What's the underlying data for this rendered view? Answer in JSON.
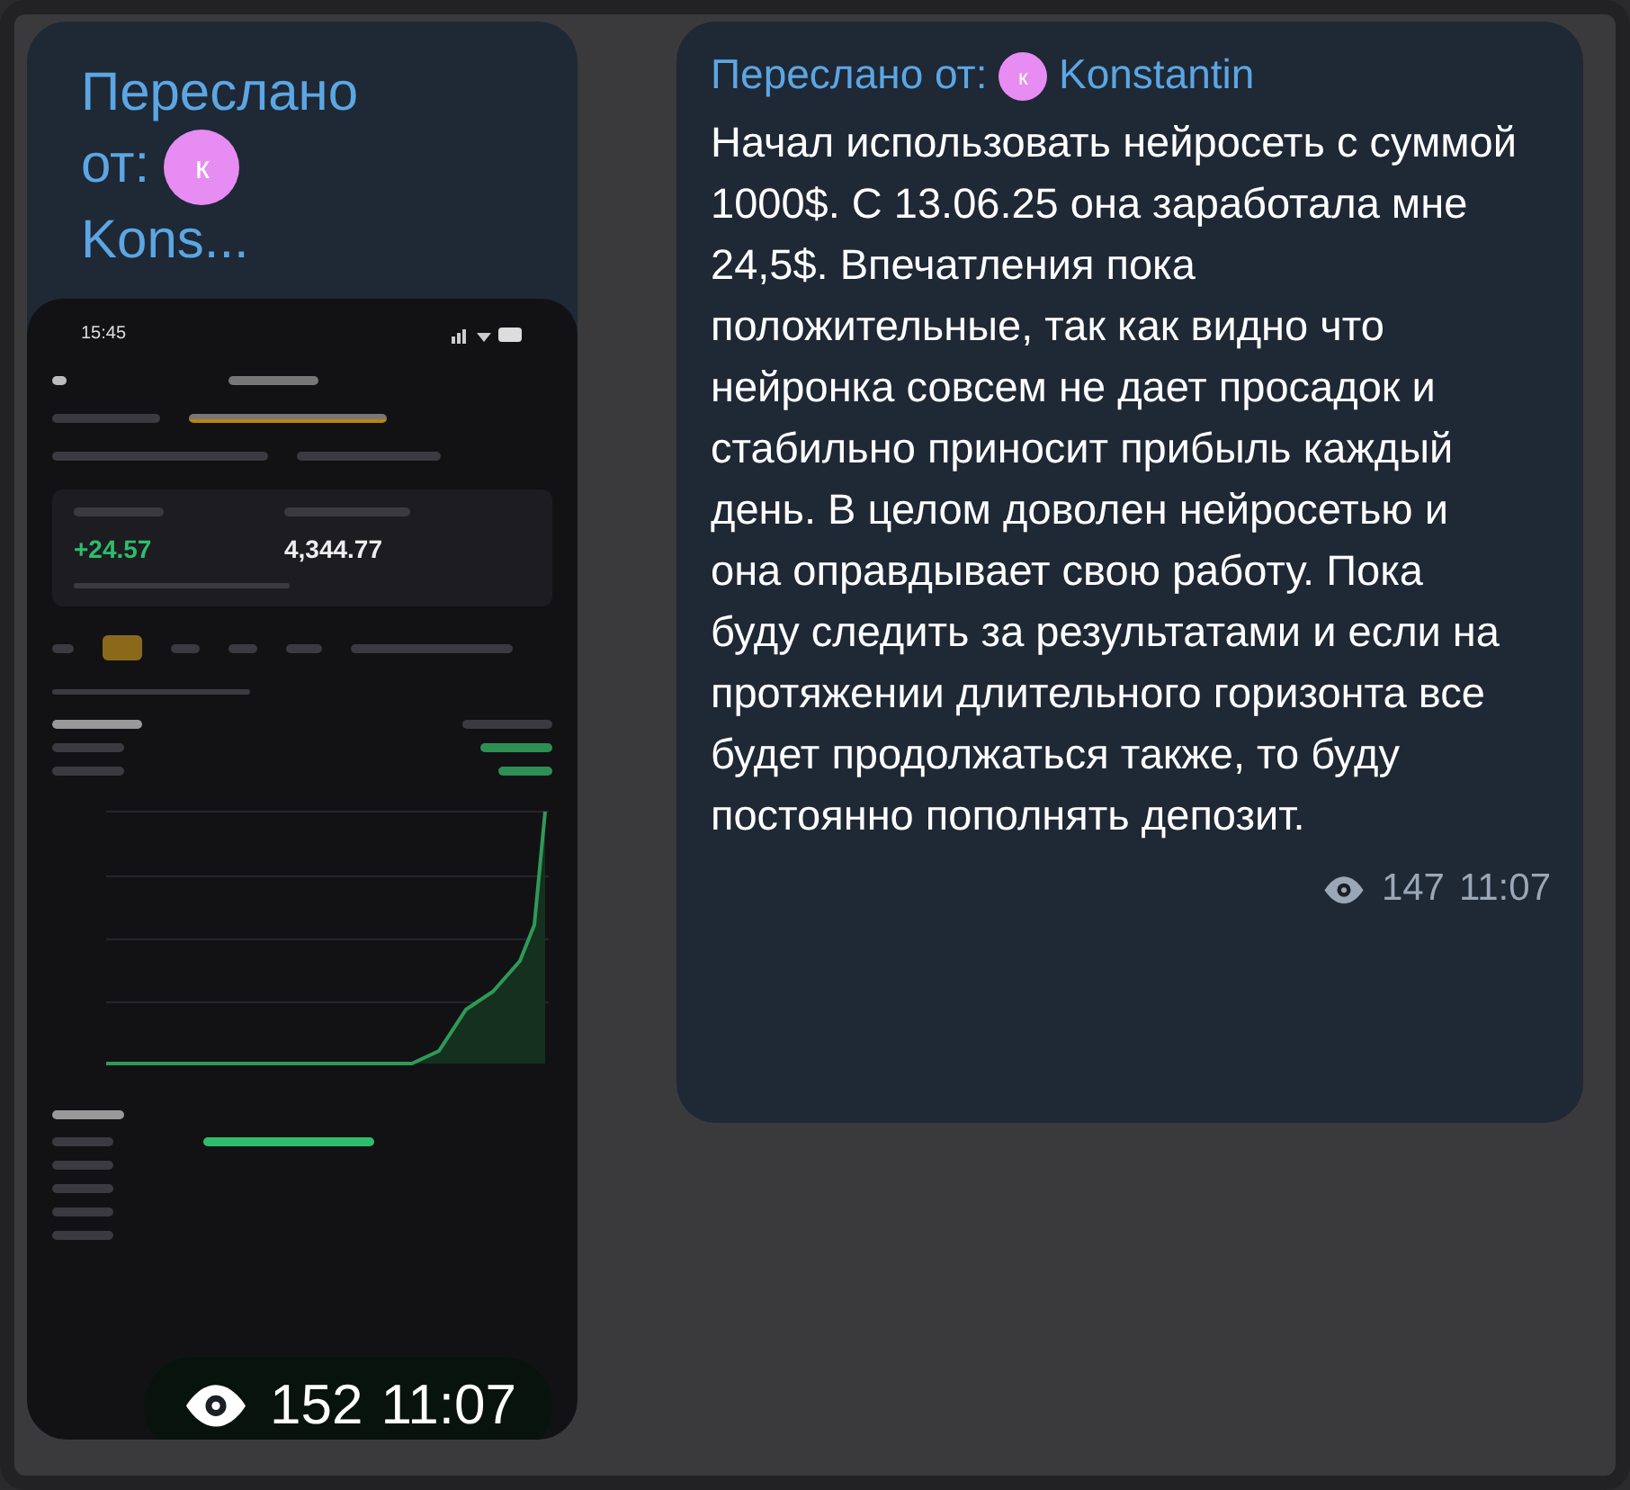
{
  "messages": [
    {
      "kind": "photo",
      "forwarded_label": "Переслано от:",
      "avatar_letter": "к",
      "sender": "Kons...",
      "screenshot": {
        "status_time": "15:45",
        "pnl_value": "+24.57",
        "volume_value": "4,344.77"
      },
      "views": "152",
      "time": "11:07"
    },
    {
      "kind": "text",
      "forwarded_label": "Переслано от:",
      "avatar_letter": "к",
      "sender": "Konstantin",
      "text": "Начал использовать нейросеть с суммой 1000$. С 13.06.25 она заработала мне 24,5$. Впечатления пока положительные, так как видно что нейронка совсем не дает просадок и стабильно приносит прибыль каждый день. В целом доволен нейросетью и она оправдывает свою работу. Пока буду следить за результатами и если на протяжении длительного горизонта все будет продолжаться также, то буду постоянно пополнять депозит.",
      "views": "147",
      "time": "11:07"
    }
  ]
}
